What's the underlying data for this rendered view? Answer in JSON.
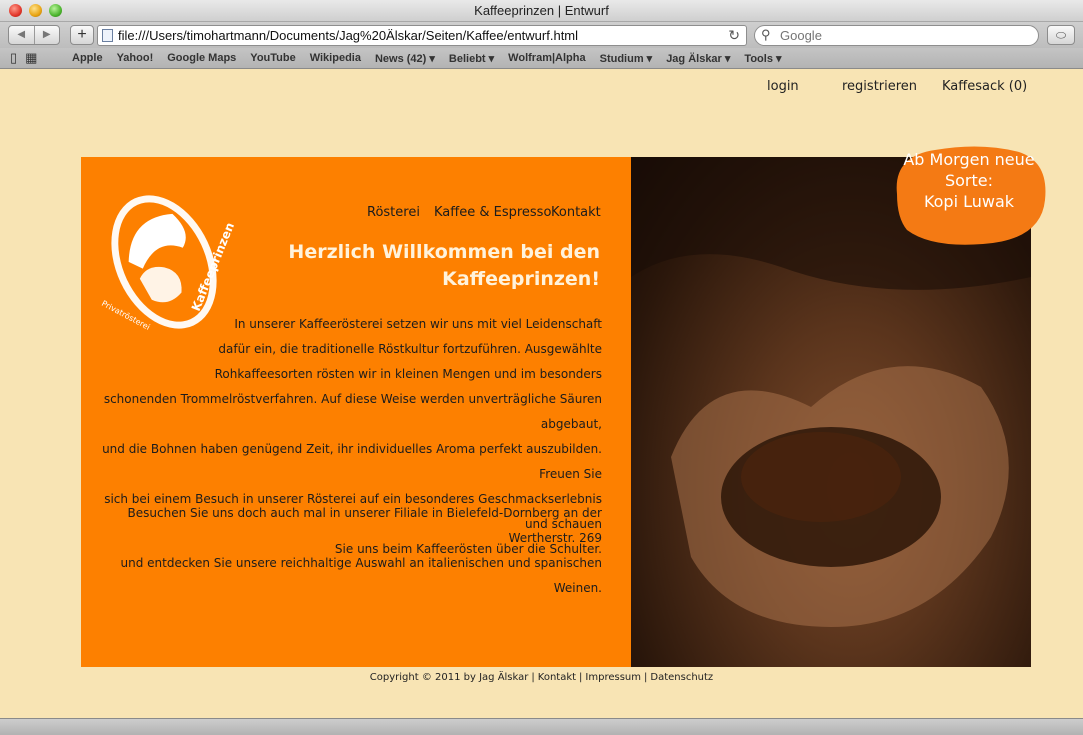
{
  "window": {
    "title": "Kaffeeprinzen | Entwurf"
  },
  "toolbar": {
    "back_label": "◀",
    "forward_label": "▶",
    "add_label": "+",
    "url": "file:///Users/timohartmann/Documents/Jag%20Älskar/Seiten/Kaffee/entwurf.html",
    "reload_label": "↻",
    "search_placeholder": "Google"
  },
  "bookmarks": [
    "Apple",
    "Yahoo!",
    "Google Maps",
    "YouTube",
    "Wikipedia",
    "News (42) ▾",
    "Beliebt ▾",
    "Wolfram|Alpha",
    "Studium ▾",
    "Jag Älskar ▾",
    "Tools ▾"
  ],
  "page": {
    "topnav": {
      "login": "login",
      "register": "registrieren",
      "cart": "Kaffesack (0)"
    },
    "subnav": {
      "roasting": "Rösterei",
      "coffee": "Kaffee & Espresso",
      "contact": "Kontakt"
    },
    "logo": {
      "brand": "Kaffeeprinzen",
      "sub": "Privatrösterei"
    },
    "welcome_line1": "Herzlich Willkommen bei den",
    "welcome_line2": "Kaffeeprinzen!",
    "paragraph1": [
      "In unserer Kaffeerösterei setzen wir uns mit viel Leidenschaft",
      "dafür ein, die traditionelle Röstkultur fortzuführen. Ausgewählte",
      "Rohkaffeesorten rösten wir in kleinen Mengen und im besonders",
      "schonenden Trommelröstverfahren. Auf diese Weise werden unverträgliche Säuren abgebaut,",
      "und die Bohnen haben genügend Zeit, ihr individuelles Aroma perfekt auszubilden. Freuen Sie",
      "sich bei einem Besuch in unserer Rösterei auf ein besonderes Geschmackserlebnis und schauen",
      "Sie uns beim Kaffeerösten über die Schulter."
    ],
    "paragraph2": [
      "Besuchen Sie uns doch auch mal in unserer Filiale in Bielefeld-Dornberg an der Wertherstr. 269",
      "und entdecken Sie unsere reichhaltige Auswahl an italienischen und spanischen Weinen."
    ],
    "badge": [
      "Ab Morgen neue",
      "Sorte:",
      "Kopi Luwak"
    ],
    "footer": {
      "copyright": "Copyright © 2011 by Jag Älskar",
      "contact": "Kontakt",
      "imprint": "Impressum",
      "privacy": "Datenschutz"
    }
  },
  "colors": {
    "background": "#f8e4b4",
    "accent_orange": "#fd8000",
    "badge_orange": "#f47a14"
  }
}
